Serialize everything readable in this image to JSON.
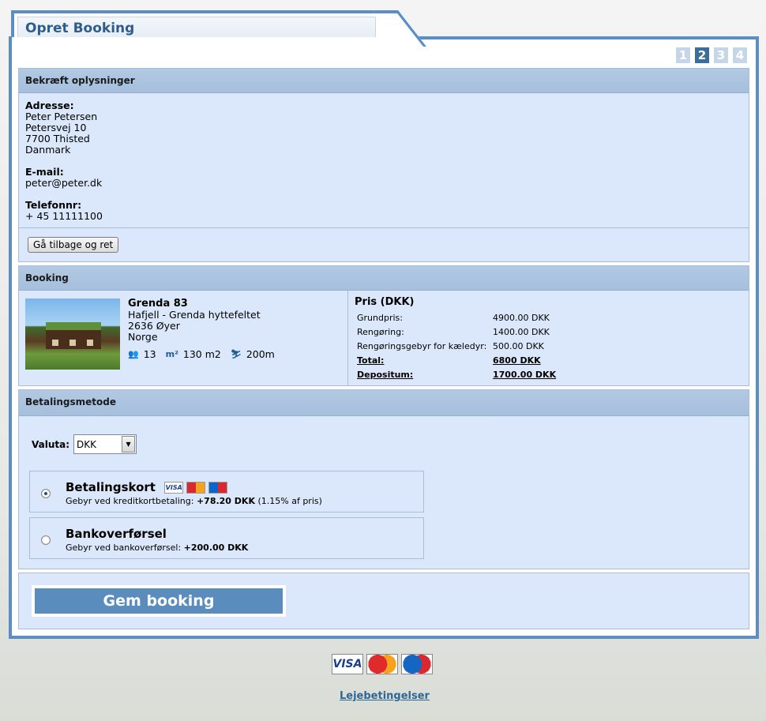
{
  "tab_title": "Opret Booking",
  "steps": [
    "1",
    "2",
    "3",
    "4"
  ],
  "active_step": "2",
  "confirm": {
    "header": "Bekræft oplysninger",
    "address_label": "Adresse:",
    "address_lines": [
      "Peter Petersen",
      "Petersvej 10",
      "7700 Thisted",
      "Danmark"
    ],
    "email_label": "E-mail:",
    "email": "peter@peter.dk",
    "phone_label": "Telefonnr:",
    "phone": "+ 45 11111100",
    "back_button": "Gå tilbage og ret"
  },
  "booking": {
    "header": "Booking",
    "property": {
      "name": "Grenda 83",
      "area": "Hafjell - Grenda hyttefeltet",
      "postal": "2636 Øyer",
      "country": "Norge",
      "persons": "13",
      "size": "130 m2",
      "ski_distance": "200m"
    },
    "price": {
      "title": "Pris (DKK)",
      "rows": [
        {
          "label": "Grundpris:",
          "value": "4900.00 DKK"
        },
        {
          "label": "Rengøring:",
          "value": "1400.00 DKK"
        },
        {
          "label": "Rengøringsgebyr for kæledyr:",
          "value": "500.00 DKK"
        }
      ],
      "total_label": "Total:",
      "total_value": "6800 DKK",
      "deposit_label": "Depositum:",
      "deposit_value": "1700.00 DKK"
    }
  },
  "payment": {
    "header": "Betalingsmetode",
    "currency_label": "Valuta:",
    "currency_value": "DKK",
    "options": [
      {
        "title": "Betalingskort",
        "fee_prefix": "Gebyr ved kreditkortbetaling:",
        "fee_amount": "+78.20 DKK",
        "fee_suffix": "(1.15% af pris)",
        "selected": true
      },
      {
        "title": "Bankoverførsel",
        "fee_prefix": "Gebyr ved bankoverførsel:",
        "fee_amount": "+200.00 DKK",
        "fee_suffix": "",
        "selected": false
      }
    ],
    "card_logos": [
      "VISA",
      "MasterCard",
      "Maestro"
    ]
  },
  "save_button": "Gem booking",
  "footer": {
    "card_logos": [
      "VISA",
      "MasterCard",
      "Maestro"
    ],
    "terms_link": "Lejebetingelser"
  },
  "colors": {
    "frame": "#5a8fc6",
    "panel_bg": "#dbe8fb",
    "panel_header": "#a5bfdd",
    "save_button": "#5b8cbe",
    "link": "#2e6792"
  }
}
